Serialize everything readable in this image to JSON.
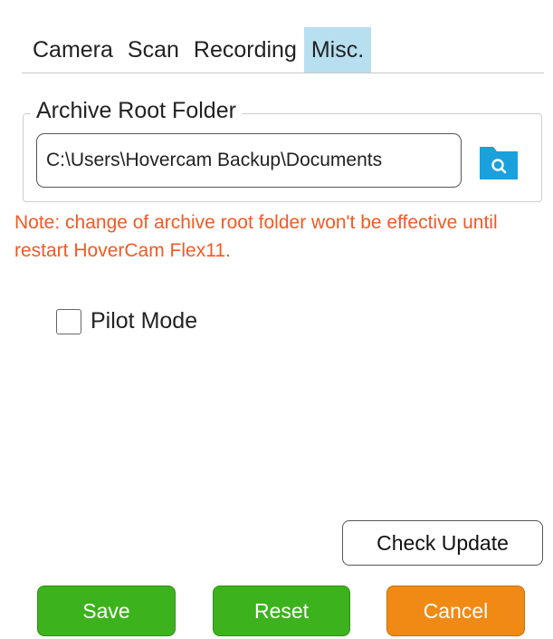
{
  "tabs": [
    {
      "label": "Camera",
      "active": false
    },
    {
      "label": "Scan",
      "active": false
    },
    {
      "label": "Recording",
      "active": false
    },
    {
      "label": "Misc.",
      "active": true
    }
  ],
  "archive": {
    "legend": "Archive Root Folder",
    "path": "C:\\Users\\Hovercam Backup\\Documents",
    "browse_icon": "folder-search-icon"
  },
  "note": {
    "text": "Note: change of archive root folder won't be effective until restart HoverCam Flex11."
  },
  "pilot_mode": {
    "label": "Pilot Mode",
    "checked": false
  },
  "check_update": {
    "label": "Check Update"
  },
  "buttons": {
    "save": "Save",
    "reset": "Reset",
    "cancel": "Cancel"
  },
  "colors": {
    "active_tab": "#b7dff0",
    "note": "#f05a24",
    "save_reset": "#3cb31c",
    "cancel": "#f08a14",
    "folder_icon": "#1aa0dc"
  }
}
